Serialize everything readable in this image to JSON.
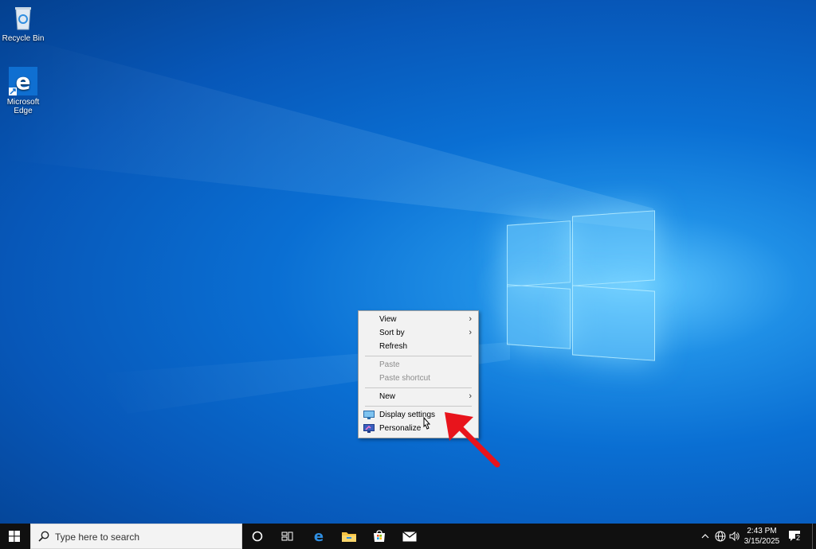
{
  "desktop": {
    "icons": [
      {
        "label": "Recycle Bin",
        "icon": "recycle-bin-icon"
      },
      {
        "label": "Microsoft Edge",
        "icon": "edge-icon"
      }
    ]
  },
  "context_menu": {
    "items": [
      {
        "label": "View",
        "submenu": true,
        "enabled": true
      },
      {
        "label": "Sort by",
        "submenu": true,
        "enabled": true
      },
      {
        "label": "Refresh",
        "enabled": true
      },
      {
        "label": "Paste",
        "enabled": false
      },
      {
        "label": "Paste shortcut",
        "enabled": false
      },
      {
        "label": "New",
        "submenu": true,
        "enabled": true
      },
      {
        "label": "Display settings",
        "icon": "display-icon",
        "enabled": true
      },
      {
        "label": "Personalize",
        "icon": "personalize-icon",
        "enabled": true
      }
    ],
    "submenu_glyph": "›"
  },
  "taskbar": {
    "search_placeholder": "Type here to search",
    "pinned": [
      "cortana-icon",
      "task-view-icon",
      "edge-icon",
      "file-explorer-icon",
      "store-icon",
      "mail-icon"
    ],
    "tray": {
      "time": "2:43 PM",
      "date": "3/15/2025",
      "notification_count": "2"
    }
  },
  "colors": {
    "annotation_arrow": "#e8141c",
    "taskbar": "#101010",
    "accent": "#0078d7"
  }
}
